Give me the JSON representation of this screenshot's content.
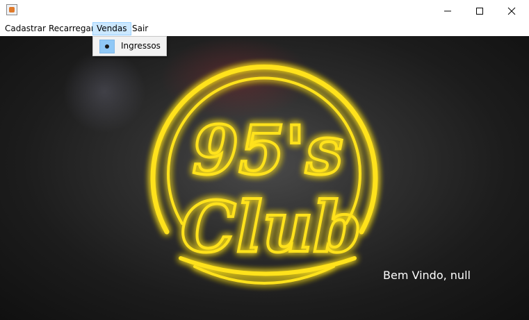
{
  "window": {
    "title": "",
    "icon": "java-cup-icon",
    "controls": [
      "minimize-icon",
      "maximize-icon",
      "close-icon"
    ]
  },
  "menubar": {
    "items": [
      {
        "label": "Cadastrar"
      },
      {
        "label": "Recarregar"
      },
      {
        "label": "Vendas",
        "active": true
      },
      {
        "label": "Sair"
      }
    ]
  },
  "dropdown": {
    "items": [
      {
        "label": "Ingressos",
        "selected": true
      }
    ]
  },
  "logo": {
    "top_text": "95's",
    "bottom_text": "Club",
    "color": "#ffe21a"
  },
  "status": {
    "welcome": "Bem Vindo, null"
  }
}
